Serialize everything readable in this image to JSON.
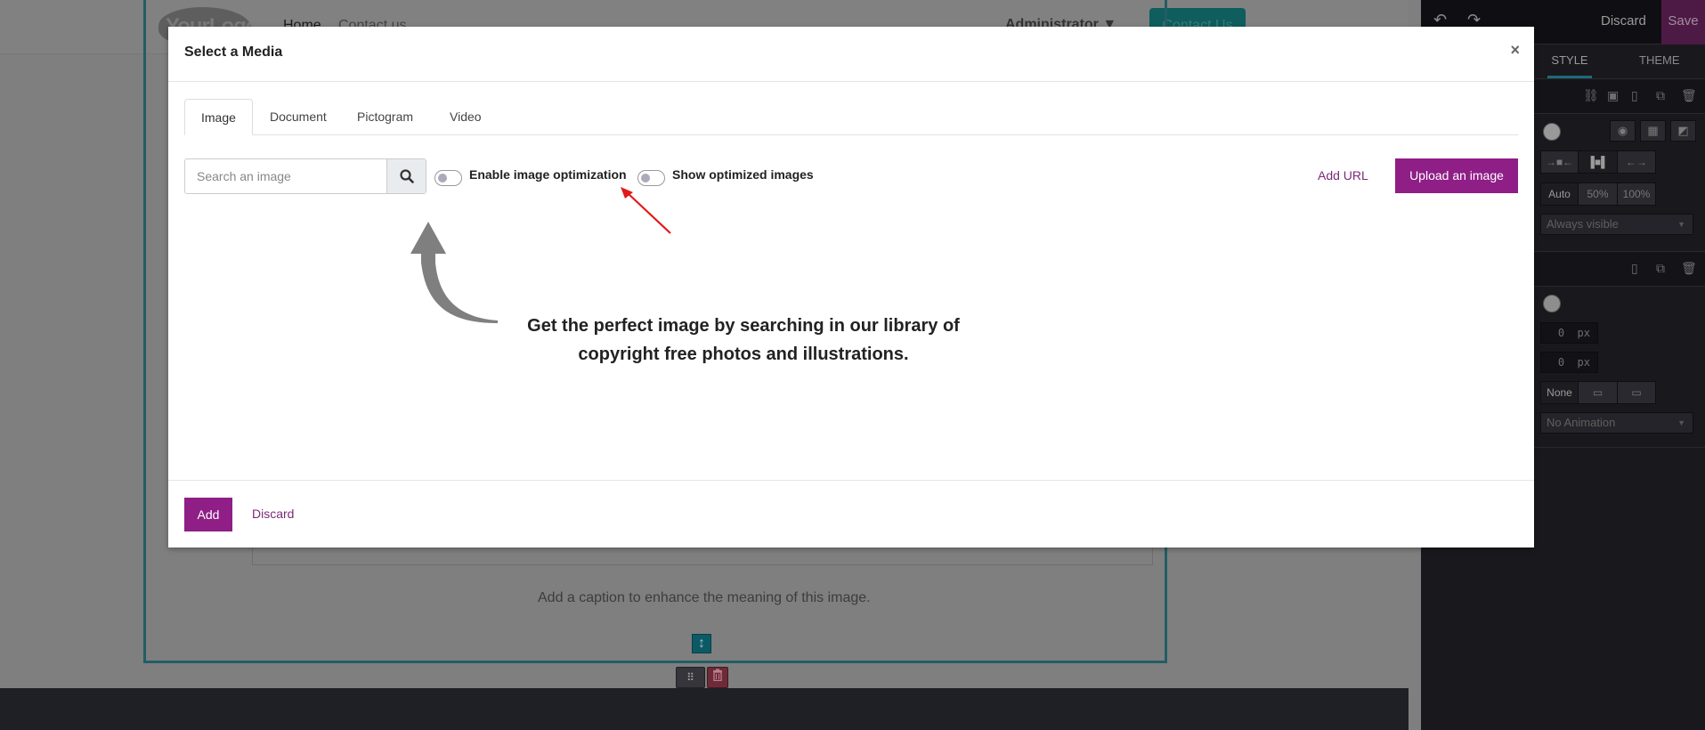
{
  "site": {
    "logo_text": "YourLogo",
    "nav": [
      "Home",
      "Contact us"
    ],
    "user_menu": "Administrator ▼",
    "cta_button": "Contact Us",
    "caption_placeholder": "Add a caption to enhance the meaning of this image.",
    "resize_icon": "↕",
    "move_icon": "⠿",
    "remove_icon": "🗑"
  },
  "editor_panel": {
    "undo_icon": "↶",
    "redo_icon": "↷",
    "discard_label": "Discard",
    "save_label": "Save",
    "tabs": [
      "STYLE",
      "THEME"
    ],
    "section1": {
      "toolbar_icons": [
        "link-icon",
        "save-icon",
        "mobile-icon",
        "duplicate-icon",
        "trash-icon"
      ],
      "media_buttons": [
        "camera-icon",
        "film-icon",
        "image-icon"
      ],
      "width_modes": [
        "→■←",
        "▐■▌",
        "←→"
      ],
      "size_options": [
        "Auto",
        "50%",
        "100%"
      ],
      "size_selected": "Auto",
      "visibility": "Always visible"
    },
    "section2": {
      "toolbar_icons": [
        "mobile-icon",
        "duplicate-icon",
        "trash-icon"
      ],
      "input1_value": "0",
      "input2_value": "0",
      "unit": "px",
      "shadow_options": [
        "None",
        "▭",
        "▭"
      ],
      "shadow_selected": "None",
      "animation": "No Animation"
    }
  },
  "modal": {
    "title": "Select a Media",
    "close_icon": "×",
    "tabs": [
      {
        "label": "Image",
        "active": true
      },
      {
        "label": "Document",
        "active": false
      },
      {
        "label": "Pictogram",
        "active": false
      },
      {
        "label": "Video",
        "active": false
      }
    ],
    "search": {
      "placeholder": "Search an image",
      "value": ""
    },
    "toggles": [
      {
        "label": "Enable image optimization",
        "on": false
      },
      {
        "label": "Show optimized images",
        "on": false
      }
    ],
    "add_url_label": "Add URL",
    "upload_label": "Upload an image",
    "hint_text": "Get the perfect image by searching in our library of copyright free photos and illustrations.",
    "footer": {
      "add_label": "Add",
      "discard_label": "Discard"
    }
  },
  "colors": {
    "brand_purple": "#8f1e86",
    "link_purple": "#7c2a78",
    "selection_teal": "#225e66",
    "annotation_red": "#e01b1b"
  }
}
